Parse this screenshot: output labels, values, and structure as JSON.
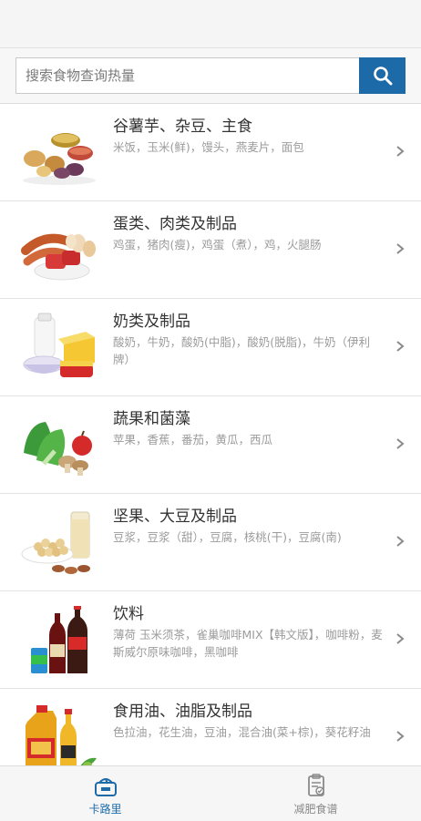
{
  "search": {
    "placeholder": "搜索食物查询热量",
    "icon": "search-icon"
  },
  "categories": [
    {
      "title": "谷薯芋、杂豆、主食",
      "desc": "米饭，玉米(鲜)，馒头，燕麦片，面包"
    },
    {
      "title": "蛋类、肉类及制品",
      "desc": "鸡蛋，猪肉(瘦)，鸡蛋（煮），鸡，火腿肠"
    },
    {
      "title": "奶类及制品",
      "desc": "酸奶，牛奶，酸奶(中脂)，酸奶(脱脂)，牛奶（伊利牌）"
    },
    {
      "title": "蔬果和菌藻",
      "desc": "苹果，香蕉，番茄，黄瓜，西瓜"
    },
    {
      "title": "坚果、大豆及制品",
      "desc": "豆浆，豆浆（甜），豆腐，核桃(干)，豆腐(南)"
    },
    {
      "title": "饮料",
      "desc": "薄荷 玉米须茶，雀巢咖啡MIX【韩文版】，咖啡粉，麦斯威尔原味咖啡，黑咖啡"
    },
    {
      "title": "食用油、油脂及制品",
      "desc": "色拉油，花生油，豆油，混合油(菜+棕)，葵花籽油"
    }
  ],
  "tabs": [
    {
      "label": "卡路里",
      "active": true
    },
    {
      "label": "减肥食谱",
      "active": false
    }
  ],
  "colors": {
    "accent": "#1d6aa8",
    "inactive": "#8a8a8a"
  }
}
